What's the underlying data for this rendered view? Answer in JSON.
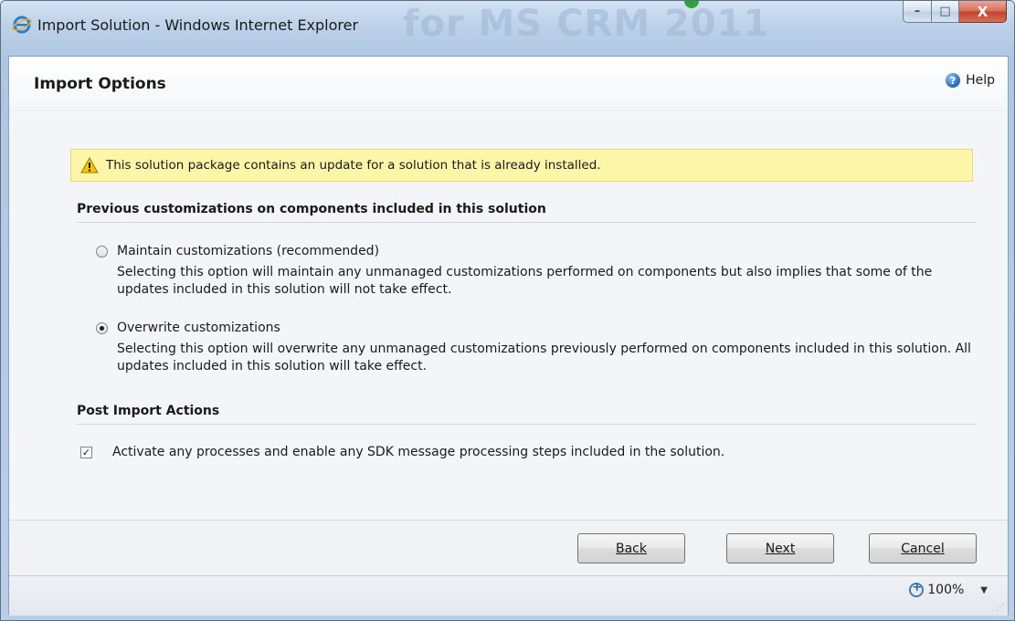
{
  "window": {
    "title": "Import Solution - Windows Internet Explorer",
    "watermark": "for MS CRM 2011",
    "controls": {
      "minimize": "–",
      "maximize": "□",
      "close": "X"
    }
  },
  "header": {
    "title": "Import Options",
    "help_label": "Help",
    "help_icon": "help-circle-icon"
  },
  "warning": {
    "icon": "warning-triangle-icon",
    "text": "This solution package contains an update for a solution that is already installed."
  },
  "customizations": {
    "heading": "Previous customizations on components included in this solution",
    "options": [
      {
        "label": "Maintain customizations (recommended)",
        "description": "Selecting this option will maintain any unmanaged customizations performed on components but also implies that some of the updates included in this solution will not take effect.",
        "checked": false
      },
      {
        "label": "Overwrite customizations",
        "description": "Selecting this option will overwrite any unmanaged customizations previously performed on components included in this solution. All updates included in this solution will take effect.",
        "checked": true
      }
    ]
  },
  "post_import": {
    "heading": "Post Import Actions",
    "checkbox_label": "Activate any processes and enable any SDK message processing steps included in the solution.",
    "checked": true
  },
  "buttons": {
    "back": "Back",
    "next": "Next",
    "cancel": "Cancel"
  },
  "status": {
    "zoom": "100%"
  },
  "colors": {
    "warning_bg": "#fbf6a8",
    "title_bar": "#bfd3ea",
    "close_button": "#c2432b"
  }
}
